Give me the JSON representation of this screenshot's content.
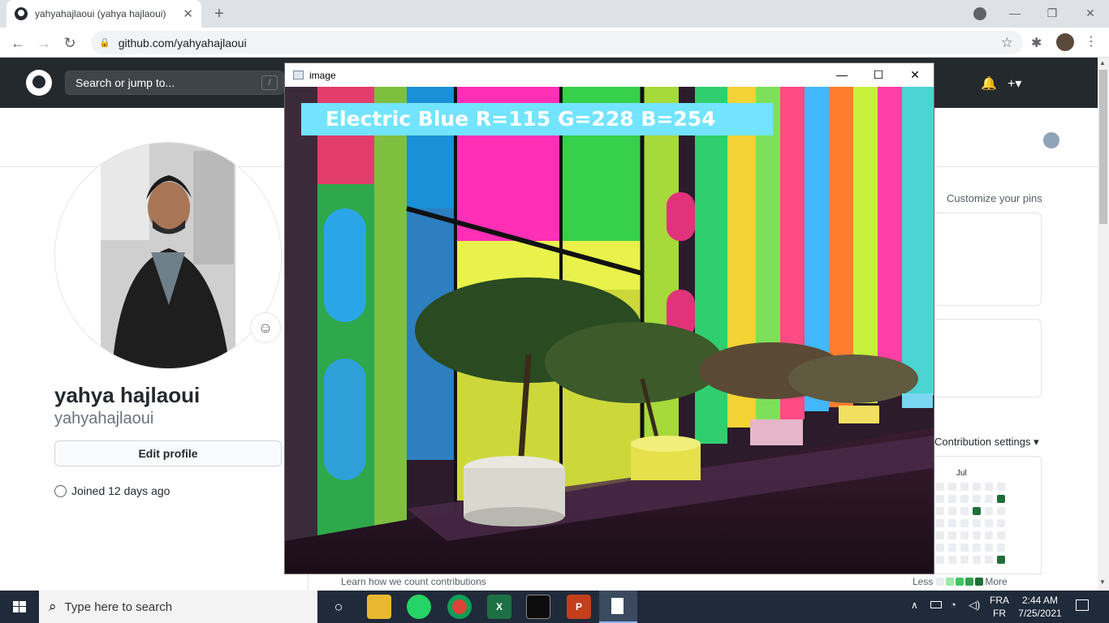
{
  "browser": {
    "tab_title": "yahyahajlaoui (yahya hajlaoui)",
    "tab_close": "✕",
    "new_tab": "+",
    "url": "github.com/yahyahajlaoui",
    "back_icon": "arrow-left-icon",
    "forward_icon": "arrow-right-icon",
    "reload_icon": "reload-icon"
  },
  "github": {
    "search_placeholder": "Search or jump to...",
    "search_shortcut": "/",
    "full_name": "yahya hajlaoui",
    "username": "yahyahajlaoui",
    "edit_profile": "Edit profile",
    "joined": "Joined 12 days ago",
    "customize_pins": "Customize your pins",
    "contribution_settings": "Contribution settings ▾",
    "month_label": "Jul",
    "learn_link": "Learn how we count contributions",
    "legend_less": "Less",
    "legend_more": "More",
    "legend_colors": [
      "#ebedf0",
      "#9be9a8",
      "#40c463",
      "#30a14e",
      "#216e39"
    ]
  },
  "image_window": {
    "title": "image",
    "color_label": "Electric Blue R=115 G=228 B=254",
    "label_color": "#73e4fe"
  },
  "taskbar": {
    "search_placeholder": "Type here to search",
    "lang_top": "FRA",
    "lang_bottom": "FR",
    "time": "2:44 AM",
    "date": "7/25/2021"
  }
}
